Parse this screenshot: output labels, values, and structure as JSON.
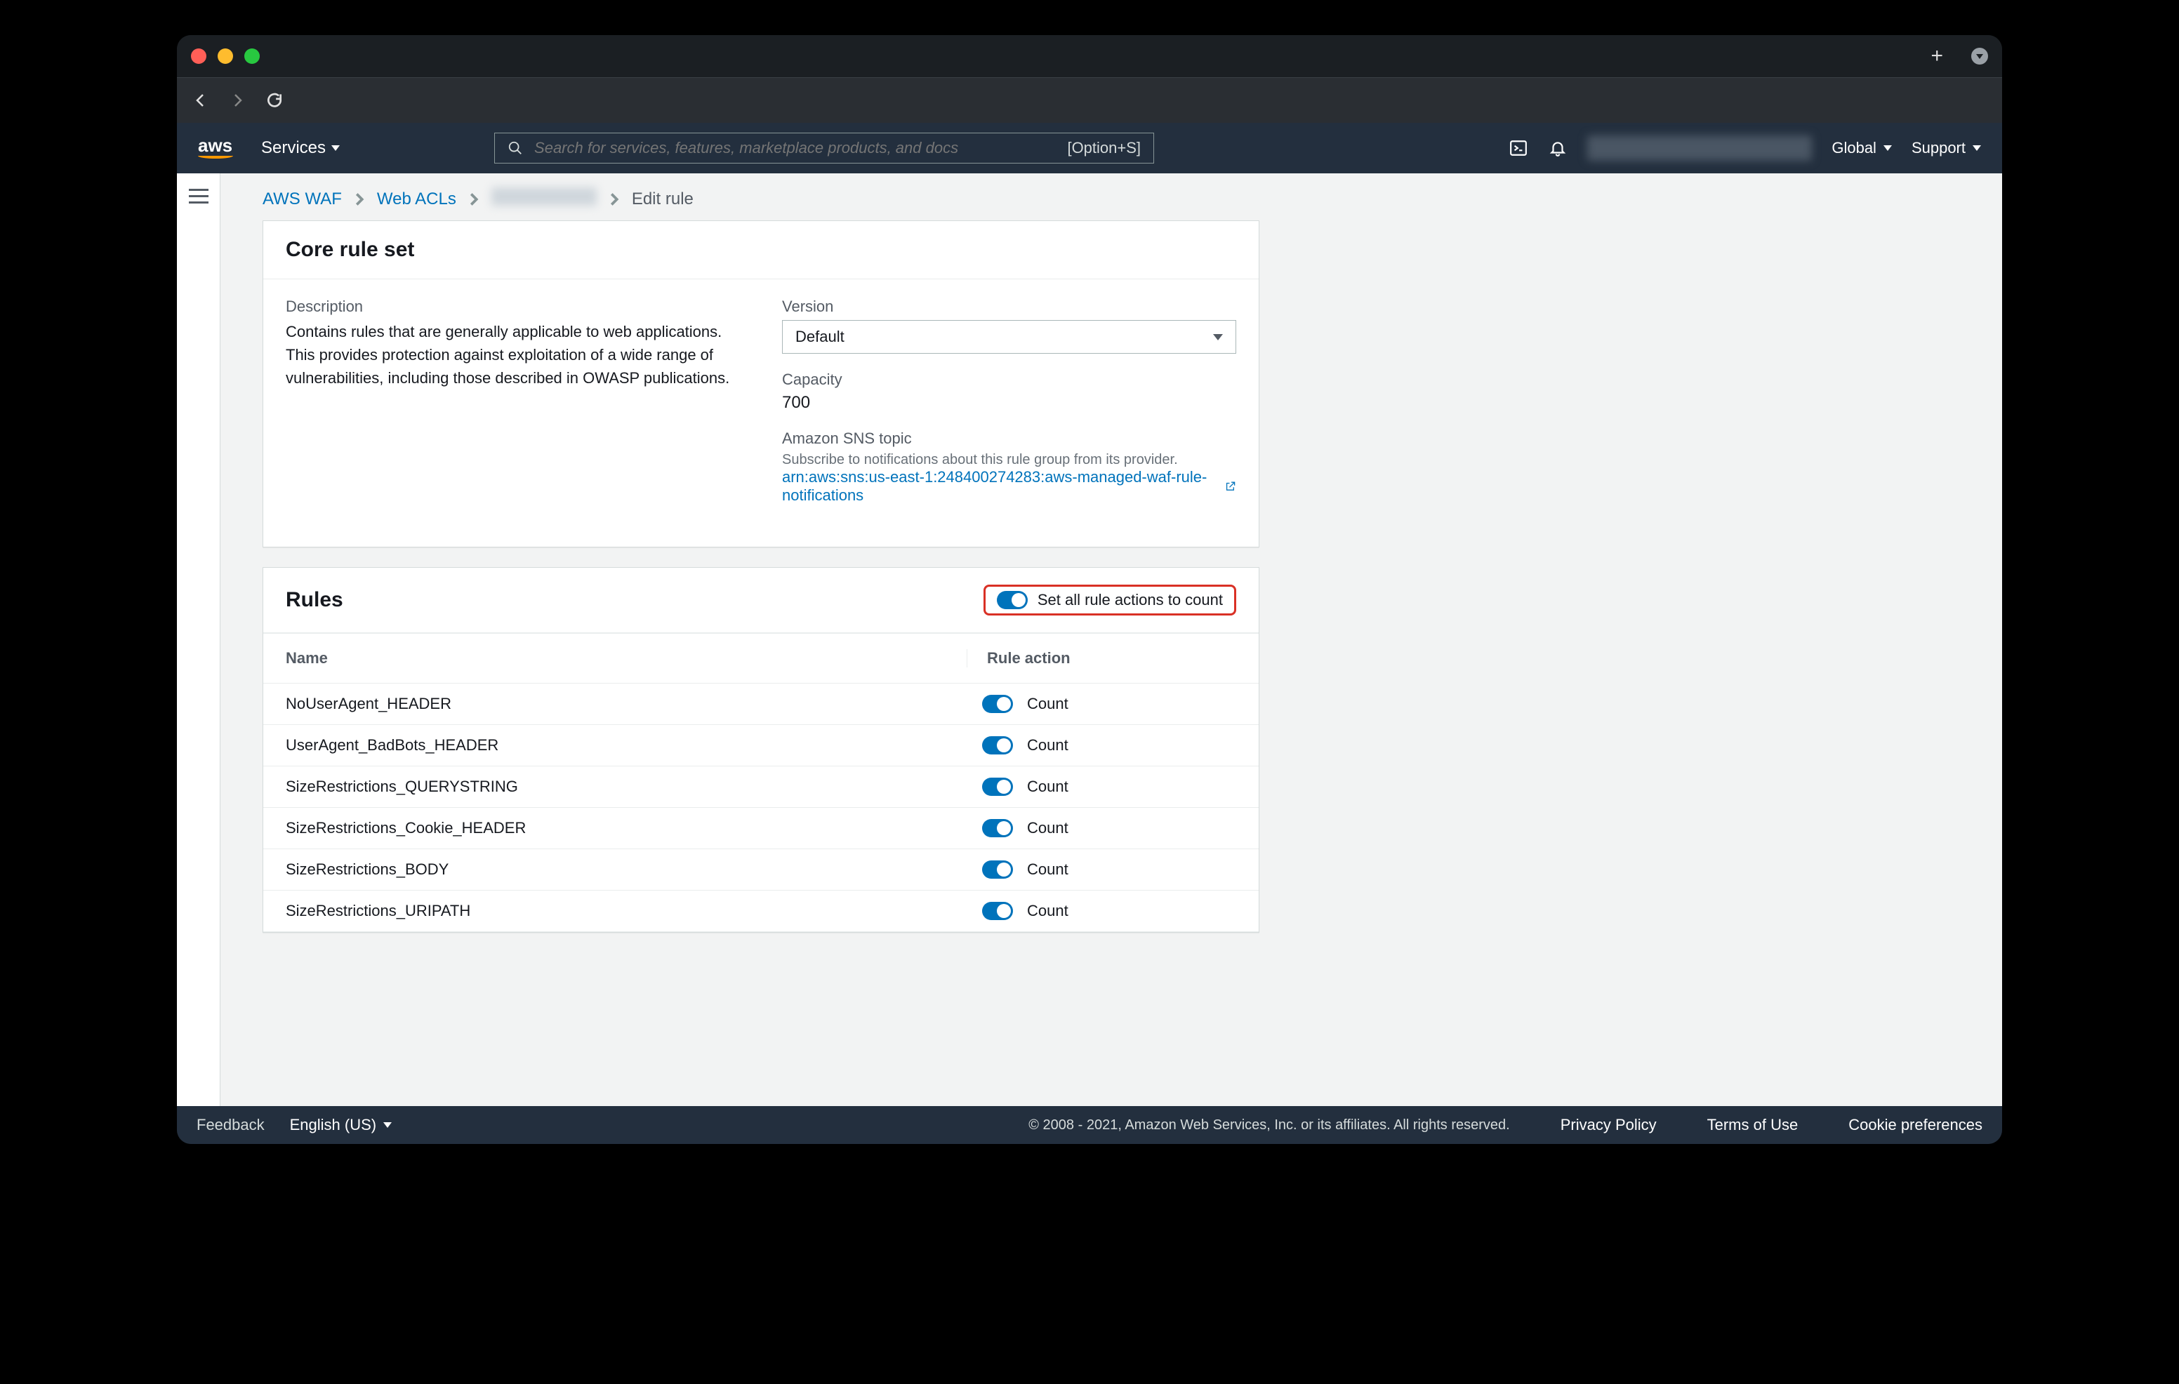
{
  "titlebar": {},
  "aws_header": {
    "services_label": "Services",
    "search_placeholder": "Search for services, features, marketplace products, and docs",
    "search_shortcut": "[Option+S]",
    "region_label": "Global",
    "support_label": "Support"
  },
  "breadcrumb": {
    "root": "AWS WAF",
    "webacls": "Web ACLs",
    "current": "Edit rule"
  },
  "core_panel": {
    "title": "Core rule set",
    "description_label": "Description",
    "description_text": "Contains rules that are generally applicable to web applications. This provides protection against exploitation of a wide range of vulnerabilities, including those described in OWASP publications.",
    "version_label": "Version",
    "version_value": "Default",
    "capacity_label": "Capacity",
    "capacity_value": "700",
    "sns_label": "Amazon SNS topic",
    "sns_help": "Subscribe to notifications about this rule group from its provider.",
    "sns_arn": "arn:aws:sns:us-east-1:248400274283:aws-managed-waf-rule-notifications"
  },
  "rules_panel": {
    "title": "Rules",
    "set_all_label": "Set all rule actions to count",
    "col_name": "Name",
    "col_action": "Rule action",
    "rows": [
      {
        "name": "NoUserAgent_HEADER",
        "action": "Count"
      },
      {
        "name": "UserAgent_BadBots_HEADER",
        "action": "Count"
      },
      {
        "name": "SizeRestrictions_QUERYSTRING",
        "action": "Count"
      },
      {
        "name": "SizeRestrictions_Cookie_HEADER",
        "action": "Count"
      },
      {
        "name": "SizeRestrictions_BODY",
        "action": "Count"
      },
      {
        "name": "SizeRestrictions_URIPATH",
        "action": "Count"
      }
    ]
  },
  "footer": {
    "feedback": "Feedback",
    "language": "English (US)",
    "copyright": "© 2008 - 2021, Amazon Web Services, Inc. or its affiliates. All rights reserved.",
    "privacy": "Privacy Policy",
    "terms": "Terms of Use",
    "cookies": "Cookie preferences"
  }
}
